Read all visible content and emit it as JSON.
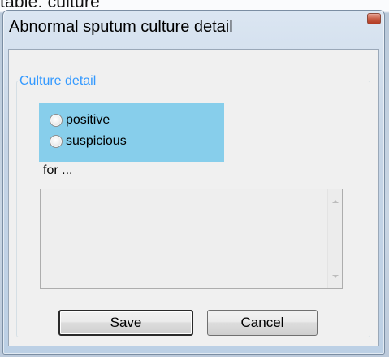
{
  "background_text": "table: culture",
  "dialog": {
    "title": "Abnormal sputum culture detail",
    "group_caption": "Culture detail",
    "options": [
      {
        "label": "positive",
        "selected": false
      },
      {
        "label": "suspicious",
        "selected": false
      }
    ],
    "for_label": "for ...",
    "list_items": [],
    "buttons": {
      "save": "Save",
      "cancel": "Cancel"
    }
  },
  "colors": {
    "group_caption": "#3399ff",
    "radio_panel": "#87ceeb",
    "close_button": "#c85d45"
  },
  "icons": {
    "close": "close-icon",
    "scroll_up": "scroll-up-arrow-icon",
    "scroll_down": "scroll-down-arrow-icon"
  }
}
